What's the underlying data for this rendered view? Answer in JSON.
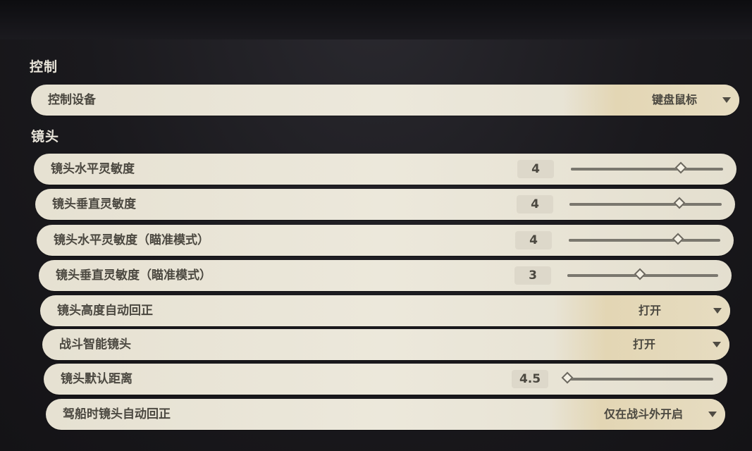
{
  "sections": {
    "control": "控制",
    "camera": "镜头"
  },
  "rows": {
    "control_device": {
      "label": "控制设备",
      "value": "键盘鼠标"
    },
    "cam_h_sens": {
      "label": "镜头水平灵敏度",
      "value": "4",
      "level": 0.73
    },
    "cam_v_sens": {
      "label": "镜头垂直灵敏度",
      "value": "4",
      "level": 0.73
    },
    "cam_h_sens_aim": {
      "label": "镜头水平灵敏度（瞄准模式）",
      "value": "4",
      "level": 0.73
    },
    "cam_v_sens_aim": {
      "label": "镜头垂直灵敏度（瞄准模式）",
      "value": "3",
      "level": 0.49
    },
    "cam_height_auto": {
      "label": "镜头高度自动回正",
      "value": "打开"
    },
    "combat_smart_cam": {
      "label": "战斗智能镜头",
      "value": "打开"
    },
    "cam_default_dist": {
      "label": "镜头默认距离",
      "value": "4.5",
      "level": 0.0
    },
    "boat_cam_auto": {
      "label": "驾船时镜头自动回正",
      "value": "仅在战斗外开启"
    }
  }
}
